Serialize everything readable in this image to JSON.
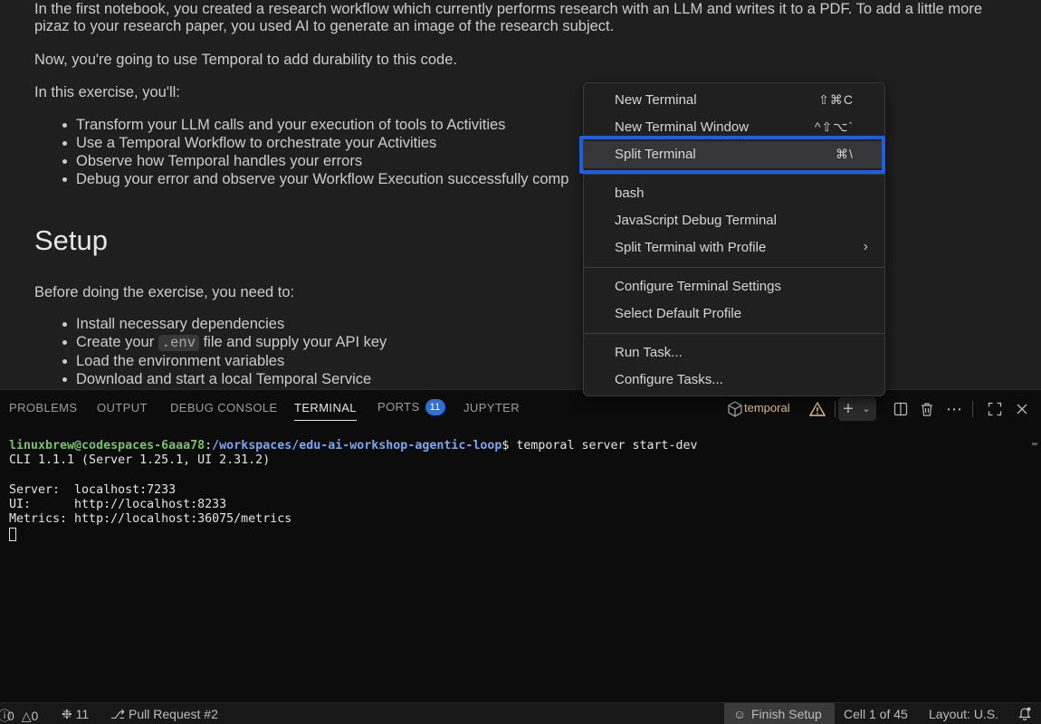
{
  "notebook": {
    "intro_line1": "In the first notebook, you created a research workflow which currently performs research with an LLM and writes it to a PDF. To add a little more",
    "intro_line2": "pizaz to your research paper, you used AI to generate an image of the research subject.",
    "durability_line": "Now, you're going to use Temporal to add durability to this code.",
    "exercise_intro": "In this exercise, you'll:",
    "exercise_items": [
      "Transform your LLM calls and your execution of tools to Activities",
      "Use a Temporal Workflow to orchestrate your Activities",
      "Observe how Temporal handles your errors",
      "Debug your error and observe your Workflow Execution successfully comp"
    ],
    "setup_heading": "Setup",
    "setup_intro": "Before doing the exercise, you need to:",
    "setup_items": {
      "item1": "Install necessary dependencies",
      "item2_pre": "Create your ",
      "item2_code": ".env",
      "item2_post": " file and supply your API key",
      "item3": "Load the environment variables",
      "item4": "Download and start a local Temporal Service"
    }
  },
  "panel": {
    "tabs": [
      {
        "label": "PROBLEMS"
      },
      {
        "label": "OUTPUT"
      },
      {
        "label": "DEBUG CONSOLE"
      },
      {
        "label": "TERMINAL"
      },
      {
        "label": "PORTS",
        "badge": "11"
      },
      {
        "label": "JUPYTER"
      }
    ],
    "active_tab": "TERMINAL",
    "terminal_name": "temporal",
    "icons": {
      "terminal": "cube-icon",
      "warning": "warning-icon",
      "add": "plus-icon",
      "dropdown": "chevron-down-icon",
      "split": "split-icon",
      "trash": "trash-icon",
      "more": "ellipsis-icon",
      "maximize": "maximize-icon",
      "close": "close-icon"
    }
  },
  "terminal": {
    "prompt_user": "linuxbrew@codespaces-6aaa78",
    "prompt_sep": ":",
    "prompt_path": "/workspaces/edu-ai-workshop-agentic-loop",
    "prompt_cmd": "$ temporal server start-dev",
    "line_cli": "CLI 1.1.1 (Server 1.25.1, UI 2.31.2)",
    "line_server": "Server:  localhost:7233",
    "line_ui": "UI:      http://localhost:8233",
    "line_metrics": "Metrics: http://localhost:36075/metrics"
  },
  "context_menu": {
    "items": [
      {
        "label": "New Terminal",
        "shortcut": "⇧⌘C"
      },
      {
        "label": "New Terminal Window",
        "shortcut": "^⇧⌥`"
      },
      {
        "label": "Split Terminal",
        "shortcut": "⌘\\"
      },
      {
        "label": "bash"
      },
      {
        "label": "JavaScript Debug Terminal"
      },
      {
        "label": "Split Terminal with Profile"
      },
      {
        "label": "Configure Terminal Settings"
      },
      {
        "label": "Select Default Profile"
      },
      {
        "label": "Run Task..."
      },
      {
        "label": "Configure Tasks..."
      }
    ],
    "highlighted": "Split Terminal"
  },
  "statusbar": {
    "errors": "0",
    "warnings": "0",
    "ports": "11",
    "pull_request": "Pull Request #2",
    "finish_setup": "Finish Setup",
    "cell": "Cell 1 of 45",
    "layout": "Layout: U.S."
  },
  "colors": {
    "background": "#1f1f1f",
    "terminal_bg": "#0c0c0d",
    "accent_blue": "#1f5ee0",
    "badge_blue": "#2f6fd6",
    "prompt_green": "#75c46b",
    "prompt_blue": "#7aa6f5",
    "warning_yellow": "#e2c08d"
  }
}
